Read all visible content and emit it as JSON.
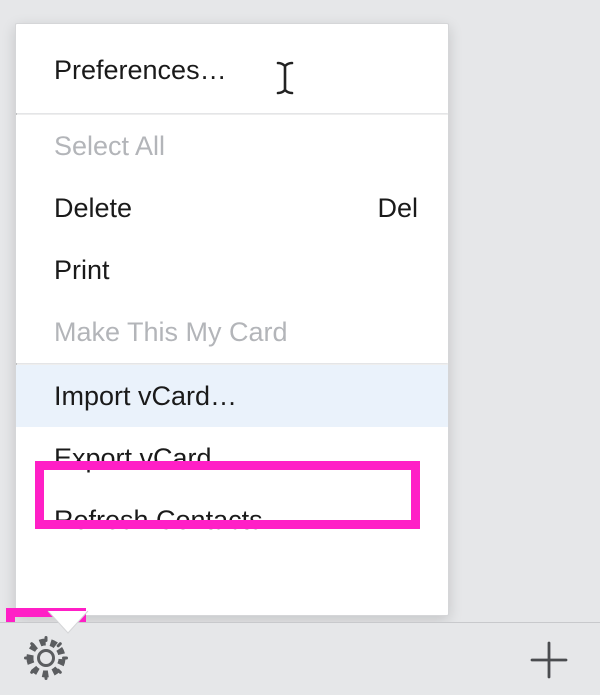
{
  "menu": {
    "preferences": {
      "label": "Preferences…",
      "enabled": true
    },
    "select_all": {
      "label": "Select All",
      "enabled": false
    },
    "delete": {
      "label": "Delete",
      "enabled": true,
      "shortcut": "Del"
    },
    "print": {
      "label": "Print",
      "enabled": true
    },
    "make_my_card": {
      "label": "Make This My Card",
      "enabled": false
    },
    "import_vcard": {
      "label": "Import vCard…",
      "enabled": true
    },
    "export_vcard": {
      "label": "Export vCard…",
      "enabled": true
    },
    "refresh": {
      "label": "Refresh Contacts",
      "enabled": true
    }
  },
  "footer": {
    "settings_button": "Settings",
    "add_button": "Add"
  },
  "annotation_color": "#ff1fc6"
}
